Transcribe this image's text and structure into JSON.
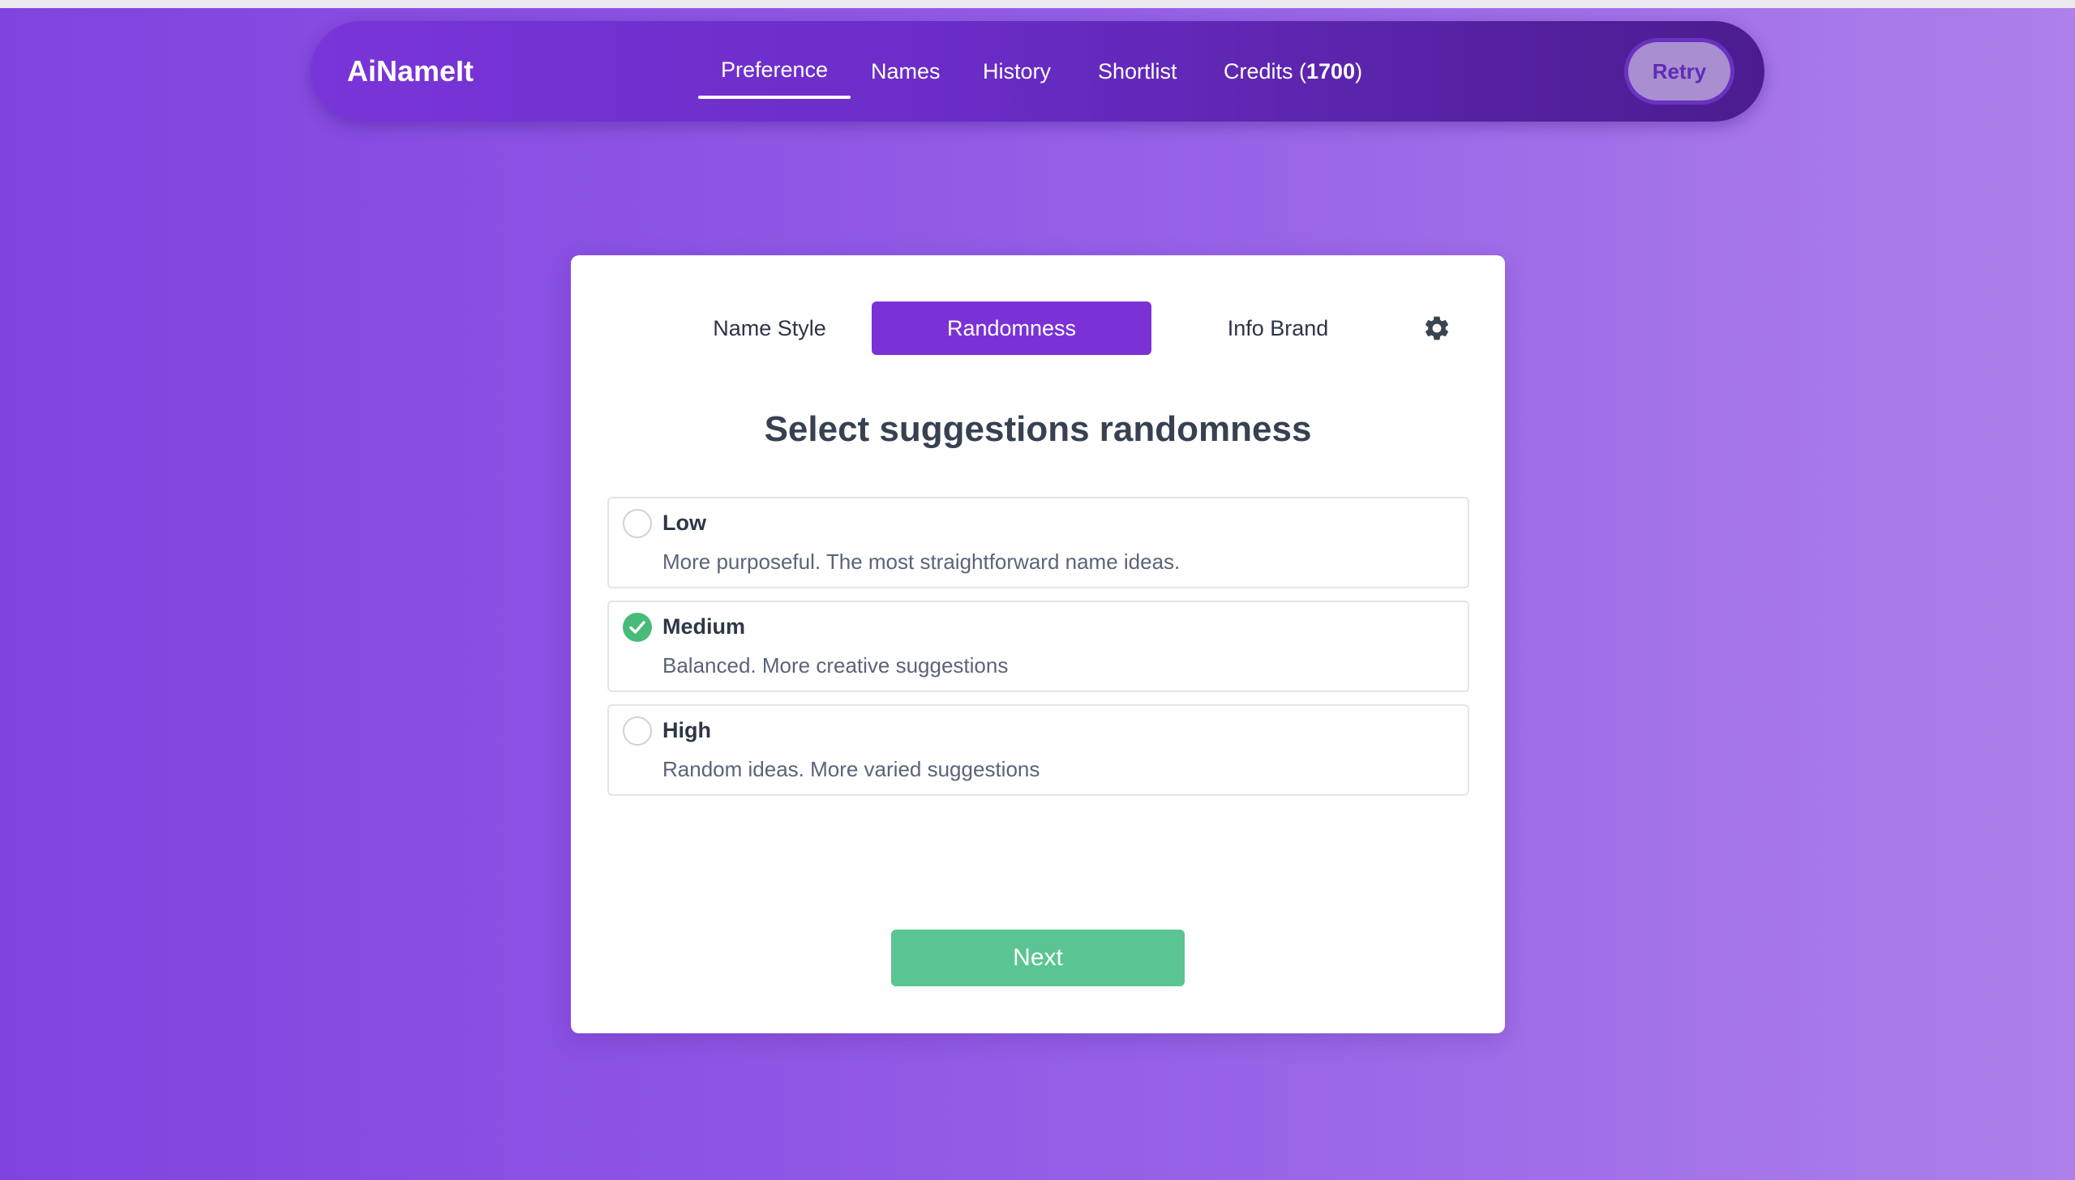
{
  "app": {
    "brand": "AiNameIt"
  },
  "nav": {
    "items": [
      {
        "label": "Preference",
        "active": true
      },
      {
        "label": "Names"
      },
      {
        "label": "History"
      },
      {
        "label": "Shortlist"
      }
    ],
    "credits_label": "Credits (",
    "credits_value": "1700",
    "credits_close": ")",
    "retry_label": "Retry"
  },
  "tabs": [
    {
      "label": "Name Style"
    },
    {
      "label": "Randomness",
      "active": true
    },
    {
      "label": "Info Brand"
    }
  ],
  "settings_icon": "gear-icon",
  "main": {
    "heading": "Select suggestions randomness",
    "options": [
      {
        "title": "Low",
        "description": "More purposeful. The most straightforward name ideas.",
        "selected": false
      },
      {
        "title": "Medium",
        "description": "Balanced. More creative suggestions",
        "selected": true
      },
      {
        "title": "High",
        "description": "Random ideas. More varied suggestions",
        "selected": false
      }
    ],
    "next_label": "Next"
  },
  "colors": {
    "accent": "#7a32d6",
    "success": "#48bb78",
    "next_button": "#5ac592"
  }
}
